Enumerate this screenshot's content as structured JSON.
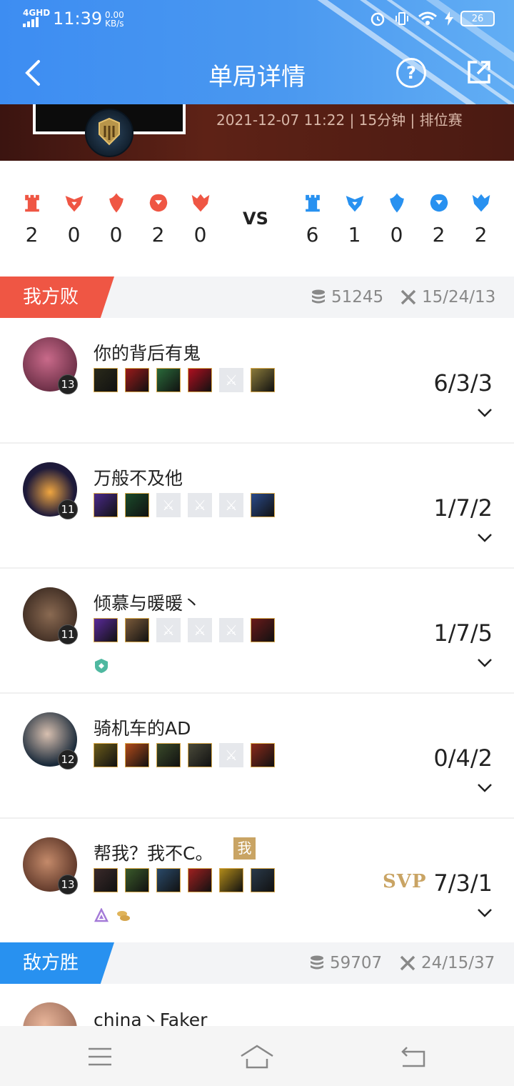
{
  "status_bar": {
    "network": "4GHD",
    "time": "11:39",
    "speed_value": "0.00",
    "speed_unit": "KB/s",
    "battery": "26"
  },
  "header": {
    "title": "单局详情"
  },
  "banner": {
    "match_info": "2021-12-07 11:22 | 15分钟 | 排位赛"
  },
  "score": {
    "vs_label": "VS",
    "red_team": [
      {
        "icon": "tower-icon",
        "value": "2"
      },
      {
        "icon": "herald-icon",
        "value": "0"
      },
      {
        "icon": "baron-icon",
        "value": "0"
      },
      {
        "icon": "dragon-icon",
        "value": "2"
      },
      {
        "icon": "elder-dragon-icon",
        "value": "0"
      }
    ],
    "blue_team": [
      {
        "icon": "tower-icon",
        "value": "6"
      },
      {
        "icon": "herald-icon",
        "value": "1"
      },
      {
        "icon": "baron-icon",
        "value": "0"
      },
      {
        "icon": "dragon-icon",
        "value": "2"
      },
      {
        "icon": "elder-dragon-icon",
        "value": "2"
      }
    ]
  },
  "my_team": {
    "label": "我方败",
    "gold": "51245",
    "kda": "15/24/13",
    "players": [
      {
        "name": "你的背后有鬼",
        "level": "13",
        "kda": "6/3/3"
      },
      {
        "name": "万般不及他",
        "level": "11",
        "kda": "1/7/2"
      },
      {
        "name": "倾慕与暖暖丶",
        "level": "11",
        "kda": "1/7/5"
      },
      {
        "name": "骑机车的AD",
        "level": "12",
        "kda": "0/4/2"
      },
      {
        "name": "帮我？我不C。",
        "level": "13",
        "kda": "7/3/1",
        "me_badge": "我",
        "title_badge": "SVP"
      }
    ]
  },
  "enemy_team": {
    "label": "敌方胜",
    "gold": "59707",
    "kda": "24/15/37",
    "players": [
      {
        "name": "china丶Faker"
      }
    ]
  },
  "colors": {
    "header": "#4a98f0",
    "lose": "#ef5644",
    "win": "#2891f0",
    "red_objective": "#ef5644",
    "blue_objective": "#2891f0",
    "svp": "#c9a464"
  }
}
